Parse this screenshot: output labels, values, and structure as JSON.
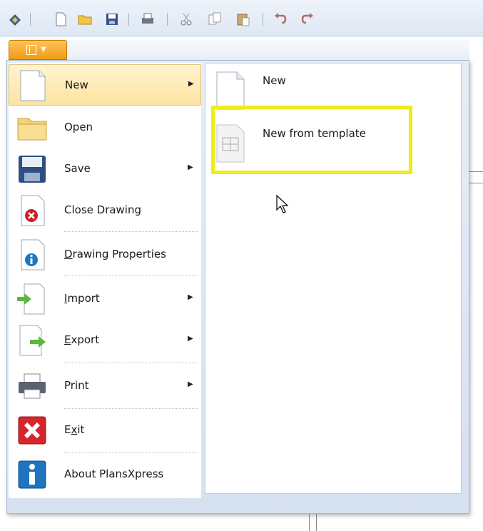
{
  "qat": {
    "icons": [
      "app-logo-icon",
      "new-document-icon",
      "open-folder-icon",
      "save-icon",
      "print-icon",
      "cut-icon",
      "copy-icon",
      "paste-icon",
      "undo-icon",
      "redo-icon"
    ]
  },
  "app_button": {
    "icon": "app-menu-icon"
  },
  "menu": {
    "items": [
      {
        "label": "New",
        "has_submenu": true,
        "icon": "new-document-icon",
        "active": true
      },
      {
        "label": "Open",
        "has_submenu": false,
        "icon": "folder-icon"
      },
      {
        "label": "Save",
        "has_submenu": true,
        "icon": "save-icon"
      },
      {
        "label": "Close Drawing",
        "has_submenu": false,
        "icon": "close-drawing-icon"
      },
      {
        "label_accel": "D",
        "label_rest": "rawing Properties",
        "has_submenu": false,
        "icon": "info-document-icon"
      },
      {
        "label_accel": "I",
        "label_rest": "mport",
        "has_submenu": true,
        "icon": "import-icon"
      },
      {
        "label_accel": "E",
        "label_rest": "xport",
        "has_submenu": true,
        "icon": "export-icon"
      },
      {
        "label": "Print",
        "has_submenu": true,
        "icon": "printer-icon"
      },
      {
        "label_pre": "E",
        "label_accel": "x",
        "label_rest": "it",
        "has_submenu": false,
        "icon": "exit-icon"
      },
      {
        "label": "About PlansXpress",
        "has_submenu": false,
        "icon": "about-icon"
      }
    ],
    "submenu_arrow": "▶"
  },
  "submenu": {
    "items": [
      {
        "label": "New",
        "icon": "blank-page-icon"
      },
      {
        "label": "New from template",
        "icon": "template-page-icon"
      }
    ]
  },
  "colors": {
    "active_bg": "#fde3a1",
    "highlight_box": "#f0ec14",
    "app_button": "#f29b12"
  }
}
